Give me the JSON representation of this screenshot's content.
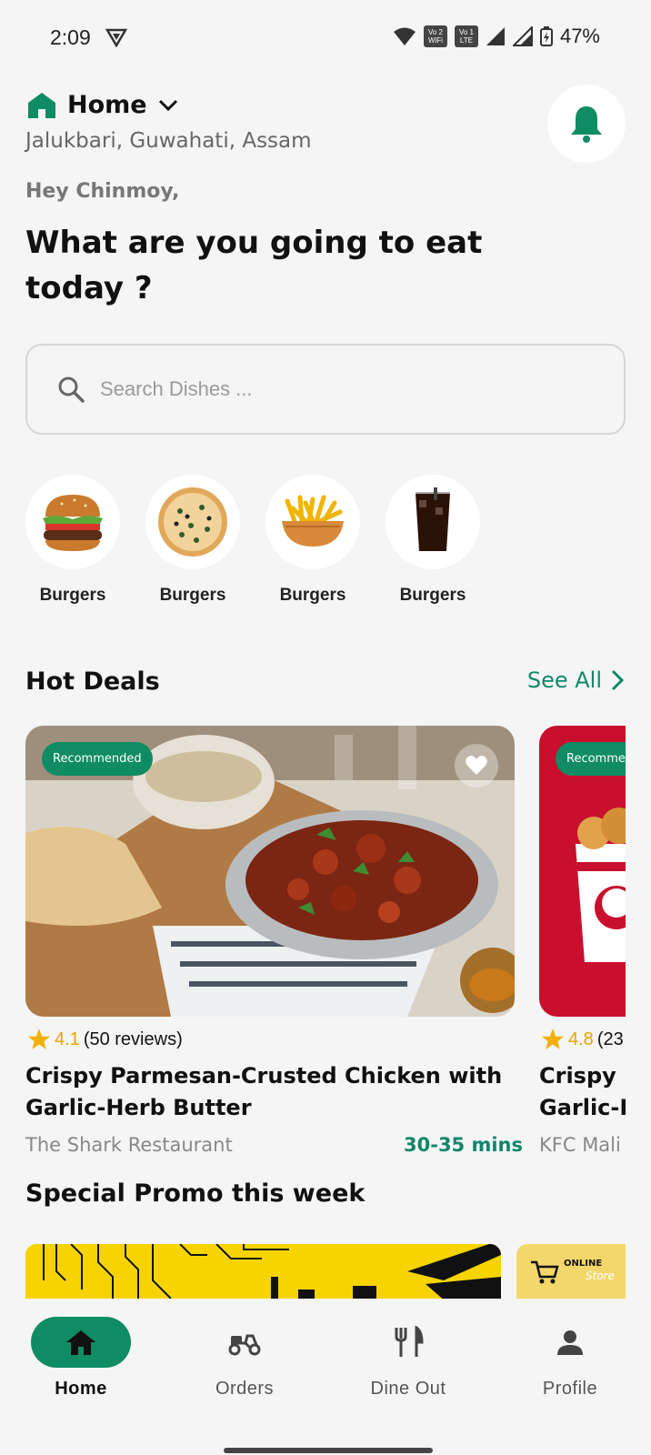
{
  "status_bar": {
    "time": "2:09",
    "battery": "47%",
    "badge_wifi": "Vo 2 WiFi",
    "badge_lte": "Vo 1 LTE"
  },
  "header": {
    "location_title": "Home",
    "location_address": "Jalukbari, Guwahati, Assam",
    "greeting": "Hey Chinmoy,",
    "headline": "What are you going to eat today ?"
  },
  "search": {
    "placeholder": "Search Dishes ..."
  },
  "categories": [
    {
      "label": "Burgers",
      "icon": "burger-icon"
    },
    {
      "label": "Burgers",
      "icon": "pizza-icon"
    },
    {
      "label": "Burgers",
      "icon": "fries-icon"
    },
    {
      "label": "Burgers",
      "icon": "cola-icon"
    }
  ],
  "hot_deals": {
    "title": "Hot Deals",
    "see_all": "See All",
    "cards": [
      {
        "badge": "Recommended",
        "rating": "4.1",
        "reviews": "(50 reviews)",
        "title": "Crispy Parmesan-Crusted Chicken with Garlic-Herb Butter",
        "restaurant": "The Shark Restaurant",
        "time": "30-35 mins"
      },
      {
        "badge": "Recommended",
        "rating": "4.8",
        "reviews": "(23",
        "title": "Crispy Parmesan-Crusted Chicken with Garlic-Herb Butter",
        "restaurant": "KFC Mali"
      }
    ]
  },
  "promo": {
    "title": "Special Promo this week",
    "store_label_1": "ONLINE",
    "store_label_2": "Store"
  },
  "bottom_nav": [
    {
      "label": "Home",
      "icon": "home-icon",
      "active": true
    },
    {
      "label": "Orders",
      "icon": "scooter-icon",
      "active": false
    },
    {
      "label": "Dine Out",
      "icon": "cutlery-icon",
      "active": false
    },
    {
      "label": "Profile",
      "icon": "person-icon",
      "active": false
    }
  ],
  "colors": {
    "accent": "#0f8c63",
    "star": "#e9a400",
    "promo_yellow": "#f7d400",
    "kfc_red": "#c8102e"
  }
}
